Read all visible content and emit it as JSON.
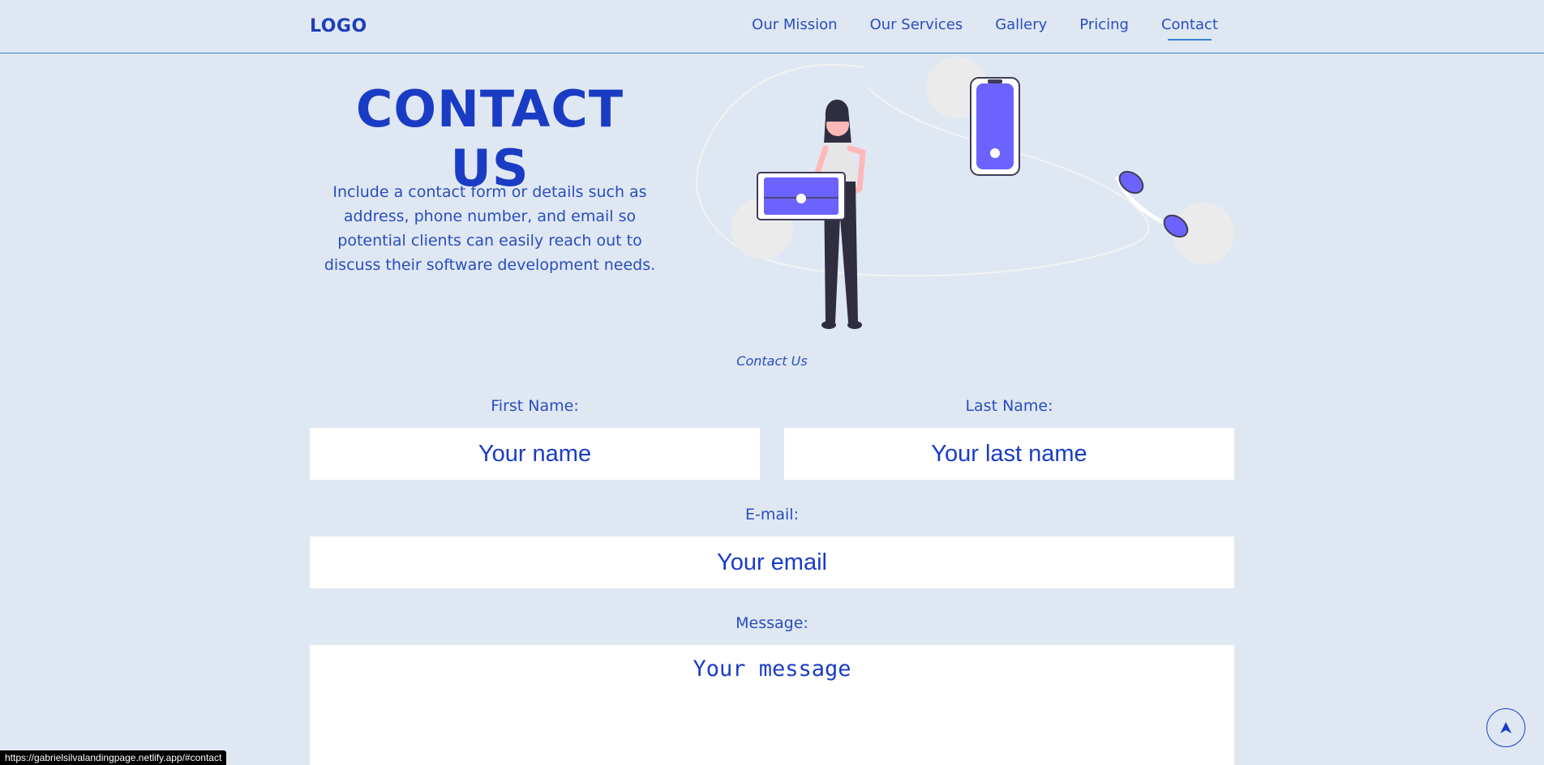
{
  "nav": {
    "logo": "LOGO",
    "links": [
      {
        "label": "Our Mission"
      },
      {
        "label": "Our Services"
      },
      {
        "label": "Gallery"
      },
      {
        "label": "Pricing"
      },
      {
        "label": "Contact"
      }
    ],
    "active": "Contact"
  },
  "hero": {
    "title": "CONTACT US",
    "description": "Include a contact form or details such as address, phone number, and email so potential clients can easily reach out to discuss their software development needs."
  },
  "form": {
    "caption": "Contact Us",
    "first_name": {
      "label": "First Name:",
      "placeholder": "Your name"
    },
    "last_name": {
      "label": "Last Name:",
      "placeholder": "Your last name"
    },
    "email": {
      "label": "E-mail:",
      "placeholder": "Your email"
    },
    "message": {
      "label": "Message:",
      "placeholder": "Your message"
    }
  },
  "status_bar": {
    "url": "https://gabrielsilvalandingpage.netlify.app/#contact"
  },
  "icons": {
    "scroll_top": "arrow-up-icon"
  },
  "colors": {
    "background": "#dfe8f2",
    "primary": "#1a3cc4",
    "accent": "#6c63ff",
    "nav_border": "#2f7fd6"
  }
}
